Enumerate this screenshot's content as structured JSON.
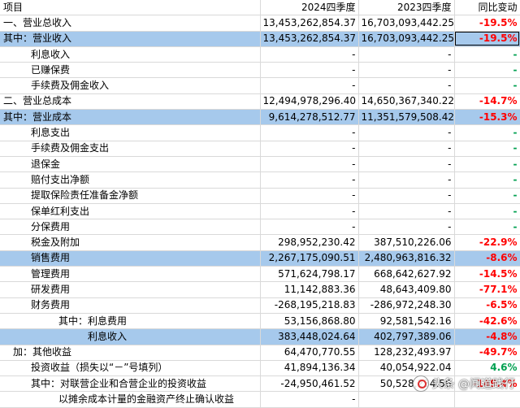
{
  "header": {
    "item": "项目",
    "col2024": "2024四季度",
    "col2023": "2023四季度",
    "change": "同比变动"
  },
  "rows": [
    {
      "label": "一、营业总收入",
      "v2024": "13,453,262,854.37",
      "v2023": "16,703,093,442.25",
      "chg": "-19.5%",
      "color": "red"
    },
    {
      "label": "其中：营业收入",
      "v2024": "13,453,262,854.37",
      "v2023": "16,703,093,442.25",
      "chg": "-19.5%",
      "color": "red"
    },
    {
      "label": "利息收入",
      "v2024": "-",
      "v2023": "-",
      "chg": "-",
      "color": "green"
    },
    {
      "label": "已赚保费",
      "v2024": "-",
      "v2023": "-",
      "chg": "-",
      "color": "green"
    },
    {
      "label": "手续费及佣金收入",
      "v2024": "-",
      "v2023": "-",
      "chg": "-",
      "color": "green"
    },
    {
      "label": "二、营业总成本",
      "v2024": "12,494,978,296.40",
      "v2023": "14,650,367,340.22",
      "chg": "-14.7%",
      "color": "red"
    },
    {
      "label": "其中：营业成本",
      "v2024": "9,614,278,512.77",
      "v2023": "11,351,579,508.42",
      "chg": "-15.3%",
      "color": "red"
    },
    {
      "label": "利息支出",
      "v2024": "-",
      "v2023": "-",
      "chg": "-",
      "color": "green"
    },
    {
      "label": "手续费及佣金支出",
      "v2024": "-",
      "v2023": "-",
      "chg": "-",
      "color": "green"
    },
    {
      "label": "退保金",
      "v2024": "-",
      "v2023": "-",
      "chg": "-",
      "color": "green"
    },
    {
      "label": "赔付支出净额",
      "v2024": "-",
      "v2023": "-",
      "chg": "-",
      "color": "green"
    },
    {
      "label": "提取保险责任准备金净额",
      "v2024": "-",
      "v2023": "-",
      "chg": "-",
      "color": "green"
    },
    {
      "label": "保单红利支出",
      "v2024": "-",
      "v2023": "-",
      "chg": "-",
      "color": "green"
    },
    {
      "label": "分保费用",
      "v2024": "-",
      "v2023": "-",
      "chg": "-",
      "color": "green"
    },
    {
      "label": "税金及附加",
      "v2024": "298,952,230.42",
      "v2023": "387,510,226.06",
      "chg": "-22.9%",
      "color": "red"
    },
    {
      "label": "销售费用",
      "v2024": "2,267,175,090.51",
      "v2023": "2,480,963,816.32",
      "chg": "-8.6%",
      "color": "red"
    },
    {
      "label": "管理费用",
      "v2024": "571,624,798.17",
      "v2023": "668,642,627.92",
      "chg": "-14.5%",
      "color": "red"
    },
    {
      "label": "研发费用",
      "v2024": "11,142,883.36",
      "v2023": "48,643,409.80",
      "chg": "-77.1%",
      "color": "red"
    },
    {
      "label": "财务费用",
      "v2024": "-268,195,218.83",
      "v2023": "-286,972,248.30",
      "chg": "-6.5%",
      "color": "red"
    },
    {
      "label": "其中：利息费用",
      "v2024": "53,156,868.80",
      "v2023": "92,581,542.16",
      "chg": "-42.6%",
      "color": "red"
    },
    {
      "label": "利息收入",
      "v2024": "383,448,024.64",
      "v2023": "402,797,389.06",
      "chg": "-4.8%",
      "color": "red"
    },
    {
      "label": "加：其他收益",
      "v2024": "64,470,770.55",
      "v2023": "128,232,493.97",
      "chg": "-49.7%",
      "color": "red"
    },
    {
      "label": "投资收益（损失以“－”号填列）",
      "v2024": "41,894,136.34",
      "v2023": "40,054,922.04",
      "chg": "4.6%",
      "color": "green"
    },
    {
      "label": "其中：对联营企业和合营企业的投资收益",
      "v2024": "-24,950,461.52",
      "v2023": "50,528,234.56",
      "chg": "-149.4%",
      "color": "red"
    },
    {
      "label": "以摊余成本计量的金融资产终止确认收益",
      "v2024": "-",
      "v2023": "",
      "chg": "",
      "color": "green"
    }
  ],
  "watermark": {
    "text": "头条 @闻道践行",
    "icon": "camera-icon"
  }
}
